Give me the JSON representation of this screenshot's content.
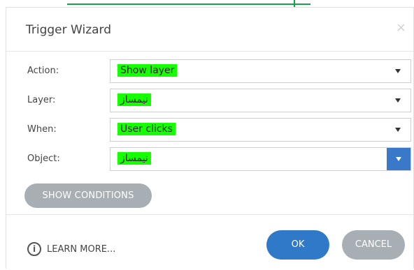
{
  "dialog": {
    "title": "Trigger Wizard",
    "close_icon": "close-icon"
  },
  "fields": [
    {
      "label": "Action:",
      "value": "Show layer"
    },
    {
      "label": "Layer:",
      "value": "نیمساز"
    },
    {
      "label": "When:",
      "value": "User clicks"
    },
    {
      "label": "Object:",
      "value": "نیمساز"
    }
  ],
  "buttons": {
    "show_conditions": "SHOW CONDITIONS",
    "learn_more": "LEARN MORE...",
    "ok": "OK",
    "cancel": "CANCEL"
  },
  "colors": {
    "highlight": "#15ff00",
    "primary": "#2f79c8",
    "secondary": "#a7aeb4",
    "accent_line": "#16a34a"
  },
  "icons": {
    "info": "info-icon",
    "dropdown": "chevron-down-icon"
  }
}
